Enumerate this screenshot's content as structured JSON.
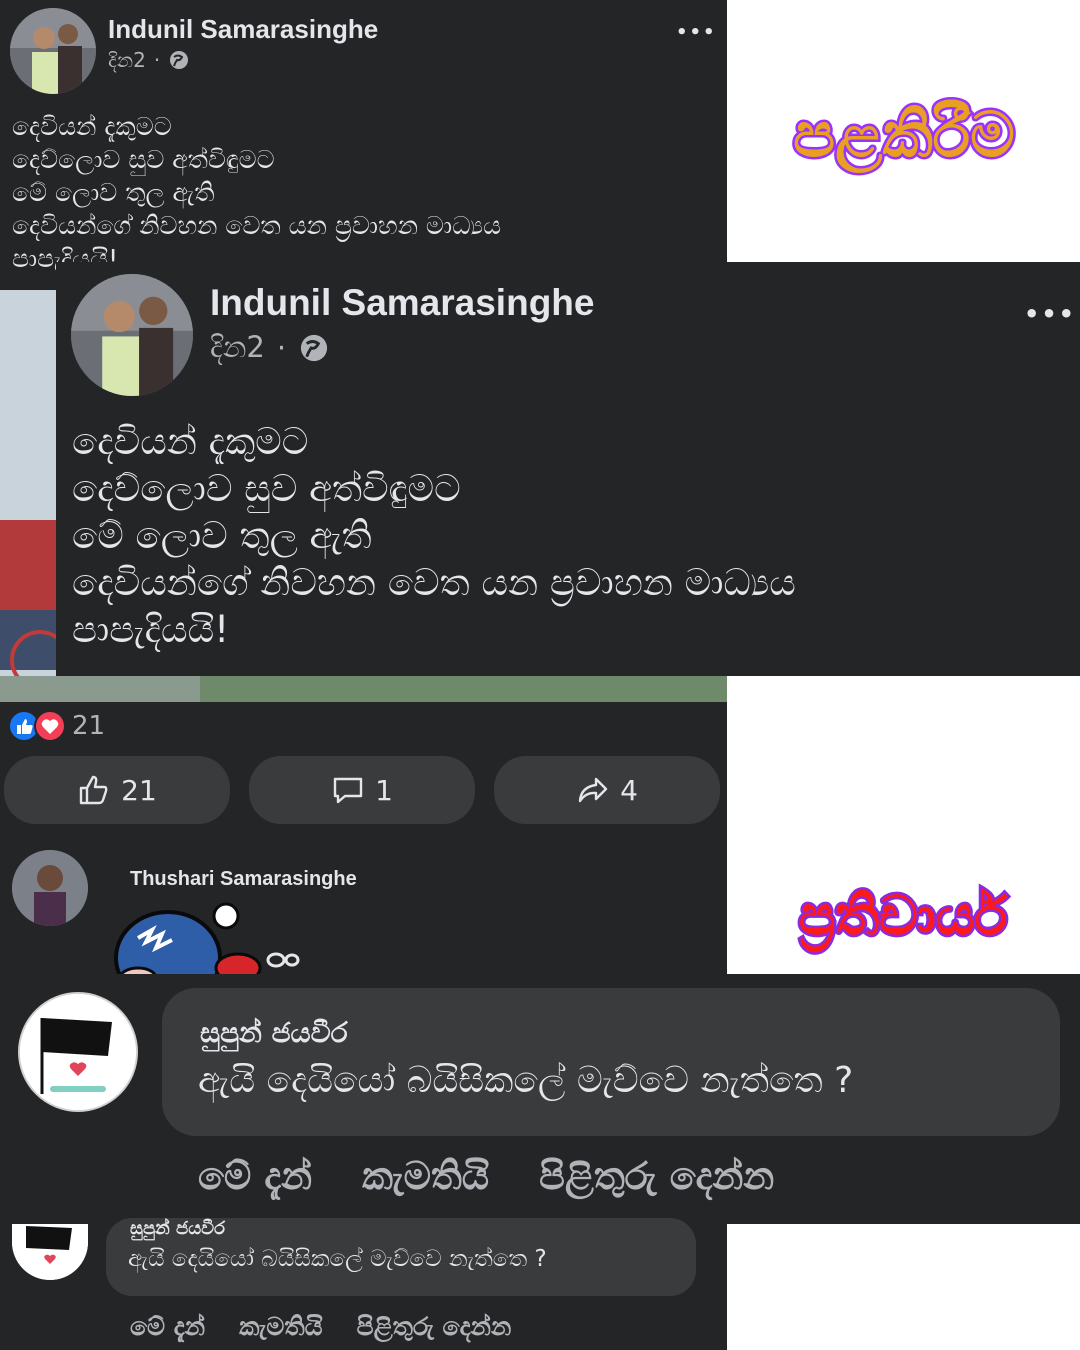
{
  "post_small": {
    "author": "Indunil Samarasinghe",
    "time": "දින2",
    "separator": "·",
    "more": "•••",
    "lines": [
      "දෙවියන් දැකුමට",
      "දෙව්ලොව සුව අත්විඳුමට",
      "මේ ලොව තුල ඇති",
      "දෙවියන්ගේ නිවහන වෙත යන ප්‍රවාහන මාධ්‍යය",
      "පාපැදියයි!"
    ]
  },
  "post_large": {
    "author": "Indunil Samarasinghe",
    "time": "දින2",
    "separator": "·",
    "more": "•••",
    "lines": [
      "දෙවියන් දැකුමට",
      "දෙව්ලොව සුව අත්විඳුමට",
      "මේ ලොව තුල ඇති",
      "දෙවියන්ගේ නිවහන වෙත යන ප්‍රවාහන මාධ්‍යය",
      "පාපැදියයි!"
    ]
  },
  "reactions": {
    "count": "21"
  },
  "action_bar": {
    "like_count": "21",
    "comment_count": "1",
    "share_count": "4"
  },
  "comment_sticker": {
    "author": "Thushari Samarasinghe"
  },
  "reply_large": {
    "author": "සුපුන් ජයවීර",
    "text": "ඇයි දෙයියෝ බයිසිකලේ මැව්වෙ නැත්තෙ ?",
    "time": "මේ දැන්",
    "like": "කැමතියි",
    "reply": "පිළිතුරු දෙන්න"
  },
  "reply_small": {
    "author": "සුපුන් ජයවීර",
    "text": "ඇයි දෙයියෝ බයිසිකලේ මැව්වෙ නැත්තෙ ?",
    "time": "මේ දැන්",
    "like": "කැමතියි",
    "reply": "පිළිතුරු දෙන්න"
  },
  "labels": {
    "top": "පළකිරීම",
    "bottom": "ප්‍රතිචාර්ය"
  },
  "colors": {
    "dark_bg": "#242526",
    "bubble": "#3a3b3c",
    "like_blue": "#1877f2",
    "love_red": "#f33e58",
    "label_top_fill": "#e8a020",
    "label_top_stroke": "#9b30ff",
    "label_bottom_fill": "#ff1a1a",
    "label_bottom_stroke": "#8a2be2"
  }
}
